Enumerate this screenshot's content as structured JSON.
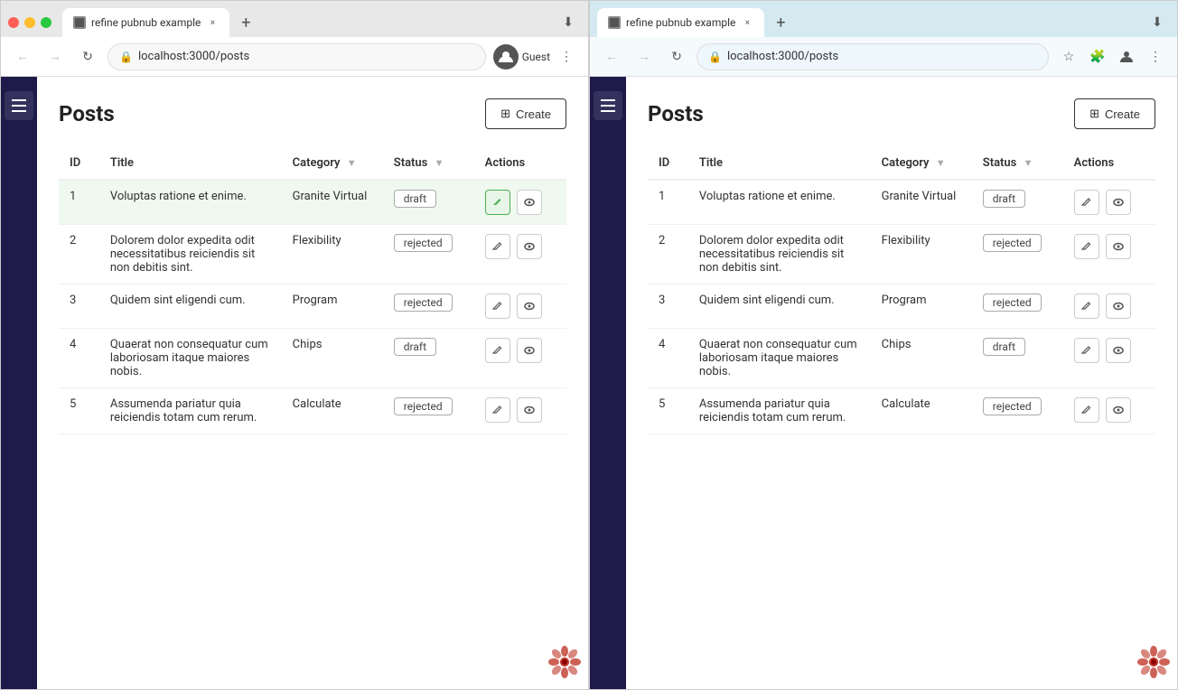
{
  "left_browser": {
    "tab_title": "refine pubnub example",
    "url": "localhost:3000/posts",
    "user": "Guest"
  },
  "right_browser": {
    "tab_title": "refine pubnub example",
    "url": "localhost:3000/posts"
  },
  "page": {
    "title": "Posts",
    "create_btn": "Create",
    "table": {
      "columns": [
        "ID",
        "Title",
        "Category",
        "Status",
        "Actions"
      ],
      "rows": [
        {
          "id": "1",
          "title": "Voluptas ratione et enime.",
          "category": "Granite Virtual",
          "status": "draft",
          "active_edit": true
        },
        {
          "id": "2",
          "title": "Dolorem dolor expedita odit necessitatibus reiciendis sit non debitis sint.",
          "category": "Flexibility",
          "status": "rejected",
          "active_edit": false
        },
        {
          "id": "3",
          "title": "Quidem sint eligendi cum.",
          "category": "Program",
          "status": "rejected",
          "active_edit": false
        },
        {
          "id": "4",
          "title": "Quaerat non consequatur cum laboriosam itaque maiores nobis.",
          "category": "Chips",
          "status": "draft",
          "active_edit": false
        },
        {
          "id": "5",
          "title": "Assumenda pariatur quia reiciendis totam cum rerum.",
          "category": "Calculate",
          "status": "rejected",
          "active_edit": false
        }
      ]
    }
  },
  "icons": {
    "hamburger": "☰",
    "create_plus": "⊞",
    "edit": "✎",
    "view": "👁",
    "back": "←",
    "forward": "→",
    "refresh": "↻",
    "lock": "🔒",
    "more": "⋮",
    "star": "☆",
    "puzzle": "🧩",
    "person": "👤",
    "flower": "✿",
    "close": "×",
    "plus": "+"
  }
}
